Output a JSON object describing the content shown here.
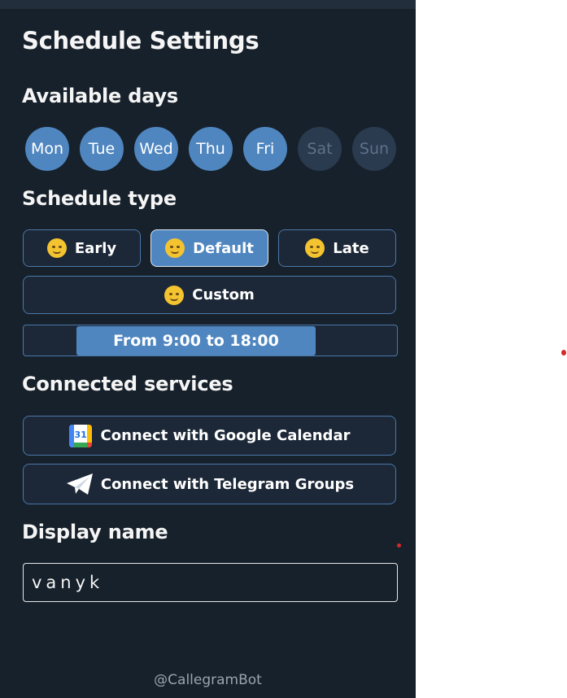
{
  "title": "Schedule Settings",
  "available_days": {
    "heading": "Available days",
    "days": [
      {
        "label": "Mon",
        "enabled": true
      },
      {
        "label": "Tue",
        "enabled": true
      },
      {
        "label": "Wed",
        "enabled": true
      },
      {
        "label": "Thu",
        "enabled": true
      },
      {
        "label": "Fri",
        "enabled": true
      },
      {
        "label": "Sat",
        "enabled": false
      },
      {
        "label": "Sun",
        "enabled": false
      }
    ]
  },
  "schedule_type": {
    "heading": "Schedule type",
    "options": [
      {
        "label": "Early",
        "icon": "yawning-face-icon",
        "selected": false
      },
      {
        "label": "Default",
        "icon": "smiling-face-icon",
        "selected": true
      },
      {
        "label": "Late",
        "icon": "sleeping-face-icon",
        "selected": false
      },
      {
        "label": "Custom",
        "icon": "star-struck-face-icon",
        "selected": false
      }
    ],
    "time_range_label": "From 9:00 to 18:00",
    "time_range": {
      "start": "9:00",
      "end": "18:00"
    }
  },
  "connected_services": {
    "heading": "Connected services",
    "google_label": "Connect with Google Calendar",
    "google_icon_number": "31",
    "telegram_label": "Connect with Telegram Groups"
  },
  "display_name": {
    "heading": "Display name",
    "value": "vanyk"
  },
  "footer": "@CallegramBot",
  "colors": {
    "panel_bg": "#17212b",
    "accent": "#4f86c0",
    "disabled_day": "#2a3a4f",
    "border": "#4a77a8"
  }
}
